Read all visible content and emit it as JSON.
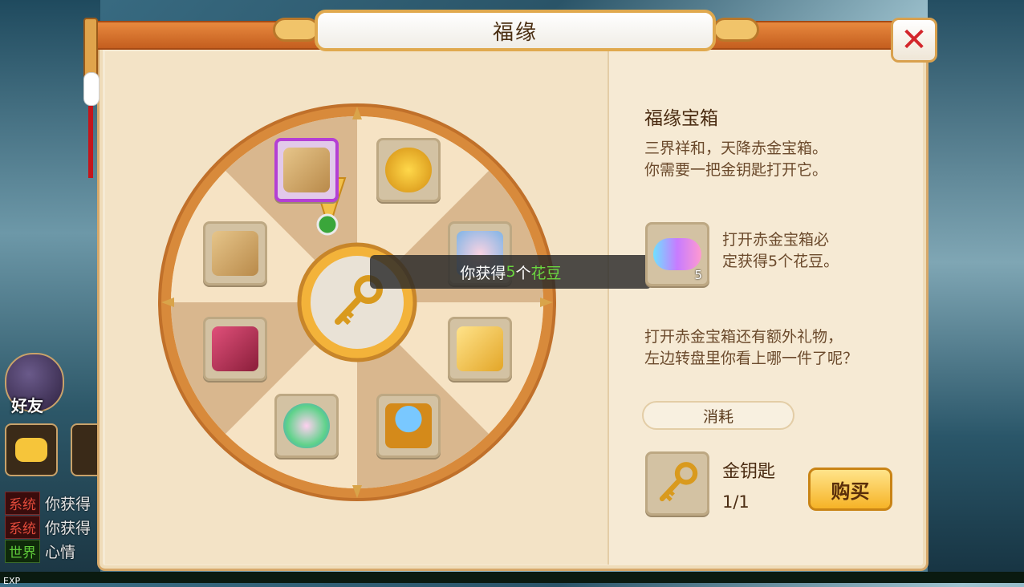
{
  "window": {
    "title": "福缘"
  },
  "side": {
    "friend_label": "好友",
    "chat": [
      {
        "channel": "系统",
        "text": "你获得"
      },
      {
        "channel": "系统",
        "text": "你获得"
      },
      {
        "channel": "世界",
        "text": "心情"
      }
    ],
    "exp_label": "EXP"
  },
  "wheel": {
    "items": [
      {
        "name": "scroll-item",
        "selected": true
      },
      {
        "name": "dream-coin-item",
        "selected": false
      },
      {
        "name": "pig-pot-item",
        "selected": false
      },
      {
        "name": "cheese-item",
        "selected": false
      },
      {
        "name": "crystal-ball-item",
        "selected": false
      },
      {
        "name": "gourd-item",
        "selected": false
      },
      {
        "name": "book-item",
        "selected": false
      },
      {
        "name": "scroll-item-2",
        "selected": false
      }
    ],
    "center_icon": "golden-key-icon"
  },
  "toast": {
    "prefix": "你获得",
    "count": "5",
    "unit": "个",
    "item": "花豆"
  },
  "info": {
    "title": "福缘宝箱",
    "desc_line1": "三界祥和，天降赤金宝箱。",
    "desc_line2": "你需要一把金钥匙打开它。",
    "reward_count": "5",
    "reward_line1": "打开赤金宝箱必",
    "reward_line2": "定获得5个花豆。",
    "extra_line1": "打开赤金宝箱还有额外礼物，",
    "extra_line2": "左边转盘里你看上哪一件了呢？",
    "cost_label": "消耗",
    "key_name": "金钥匙",
    "key_count": "1/1",
    "buy_label": "购买"
  },
  "colors": {
    "accent": "#e8893e",
    "select": "#b43fd4",
    "highlight": "#6bd63f"
  }
}
